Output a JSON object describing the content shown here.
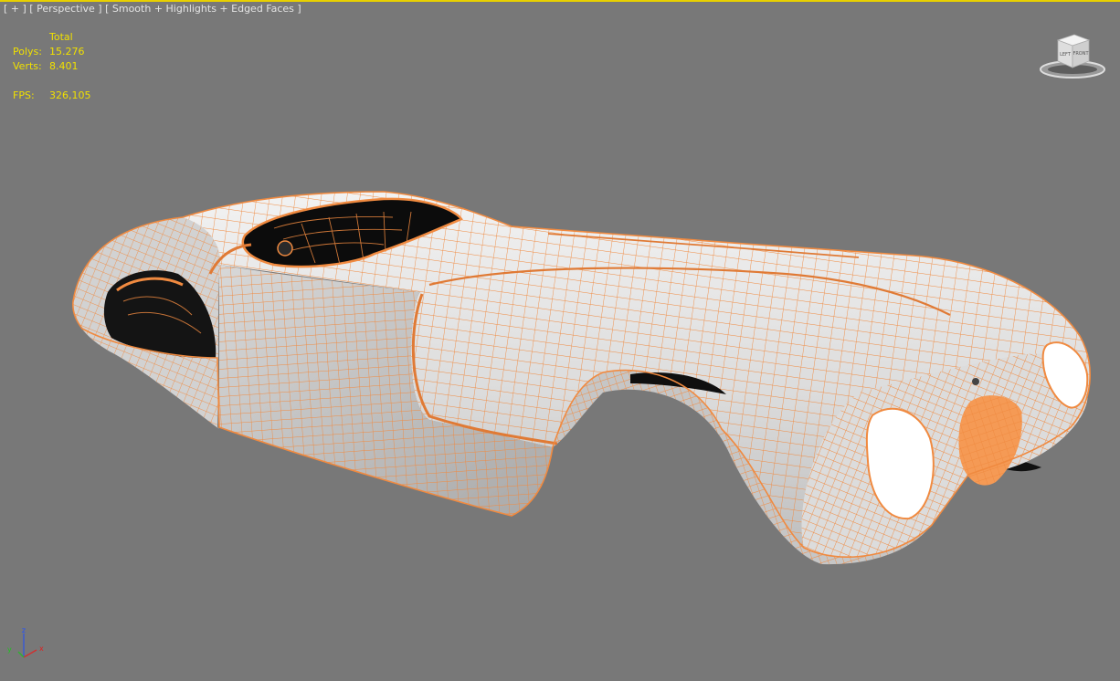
{
  "viewport": {
    "menu_plus": "[ + ]",
    "menu_view": "[ Perspective ]",
    "menu_shading": "[ Smooth + Highlights + Edged Faces ]"
  },
  "stats": {
    "header": "Total",
    "polys_label": "Polys:",
    "polys_value": "15.276",
    "verts_label": "Verts:",
    "verts_value": "8.401",
    "fps_label": "FPS:",
    "fps_value": "326,105"
  },
  "viewcube": {
    "left_face": "LEFT",
    "front_face": "FRONT"
  },
  "axis": {
    "x": "x",
    "y": "y",
    "z": "z"
  },
  "colors": {
    "background": "#787878",
    "active_border": "#e8d000",
    "stats_text": "#f0e000",
    "wire": "#f08a40",
    "surface": "#e4e4e4"
  }
}
